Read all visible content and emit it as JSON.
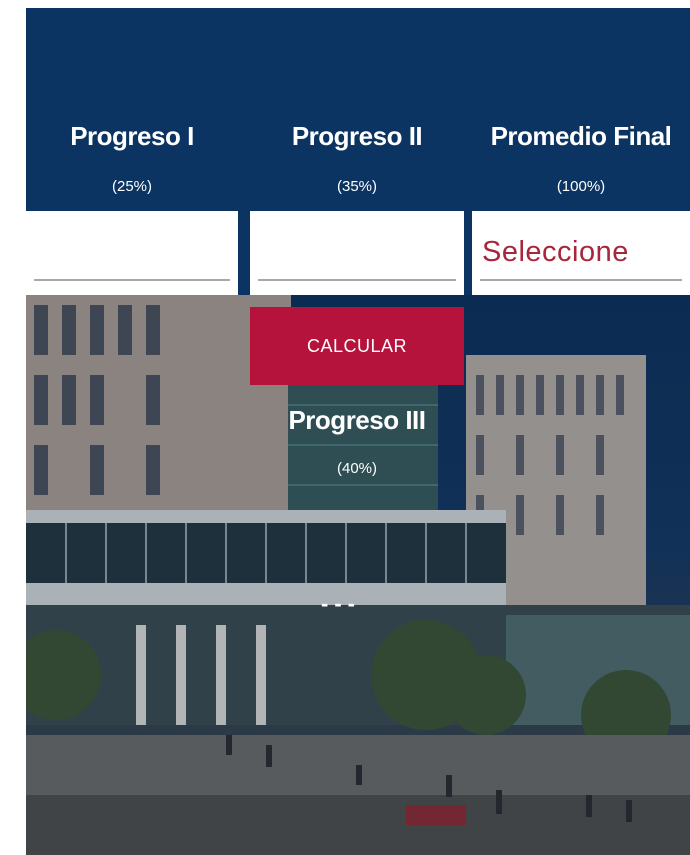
{
  "columns": [
    {
      "title": "Progreso I",
      "weight": "(25%)",
      "value": ""
    },
    {
      "title": "Progreso II",
      "weight": "(35%)",
      "value": ""
    },
    {
      "title": "Promedio Final",
      "weight": "(100%)",
      "select_value": "Seleccione"
    }
  ],
  "calculate_label": "CALCULAR",
  "progreso3": {
    "title": "Progreso III",
    "weight": "(40%)",
    "result": "---"
  },
  "colors": {
    "panel_bg": "#0b3462",
    "button_bg": "#b5123c",
    "select_text": "#a8263c",
    "text": "#ffffff"
  }
}
